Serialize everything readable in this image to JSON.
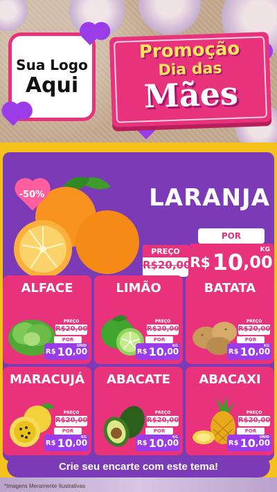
{
  "logo": {
    "line1": "Sua Logo",
    "line2": "Aqui"
  },
  "promo": {
    "line1": "Promoção",
    "line2": "Dia das",
    "line3": "Mães"
  },
  "hero": {
    "discount": "-50%",
    "name": "LARANJA",
    "preco_label": "PREÇO",
    "old_price": "R$20,00",
    "por_label": "POR",
    "currency": "R$",
    "price_int": "10",
    "price_dec": ",00",
    "unit": "KG"
  },
  "products": [
    {
      "name": "ALFACE",
      "preco_label": "PREÇO",
      "old_price": "R$20,00",
      "por_label": "POR",
      "currency": "R$",
      "price_int": "10",
      "price_dec": ",00",
      "unit": "UNID"
    },
    {
      "name": "LIMÃO",
      "preco_label": "PREÇO",
      "old_price": "R$20,00",
      "por_label": "POR",
      "currency": "R$",
      "price_int": "10",
      "price_dec": ",00",
      "unit": "KG"
    },
    {
      "name": "BATATA",
      "preco_label": "PREÇO",
      "old_price": "R$20,00",
      "por_label": "POR",
      "currency": "R$",
      "price_int": "10",
      "price_dec": ",00",
      "unit": "KG"
    },
    {
      "name": "MARACUJÁ",
      "preco_label": "PREÇO",
      "old_price": "R$20,00",
      "por_label": "POR",
      "currency": "R$",
      "price_int": "10",
      "price_dec": ",00",
      "unit": "KG"
    },
    {
      "name": "ABACATE",
      "preco_label": "PREÇO",
      "old_price": "R$20,00",
      "por_label": "POR",
      "currency": "R$",
      "price_int": "10",
      "price_dec": ",00",
      "unit": "KG"
    },
    {
      "name": "ABACAXI",
      "preco_label": "PREÇO",
      "old_price": "R$20,00",
      "por_label": "POR",
      "currency": "R$",
      "price_int": "10",
      "price_dec": ",00",
      "unit": "UNID"
    }
  ],
  "cta": "Crie seu encarte com este tema!",
  "disclaimer": "*Imagens Meramente Ilustrativas",
  "colors": {
    "pink": "#e8327c",
    "purple": "#7b3ab6",
    "yellow": "#f5c21c"
  }
}
